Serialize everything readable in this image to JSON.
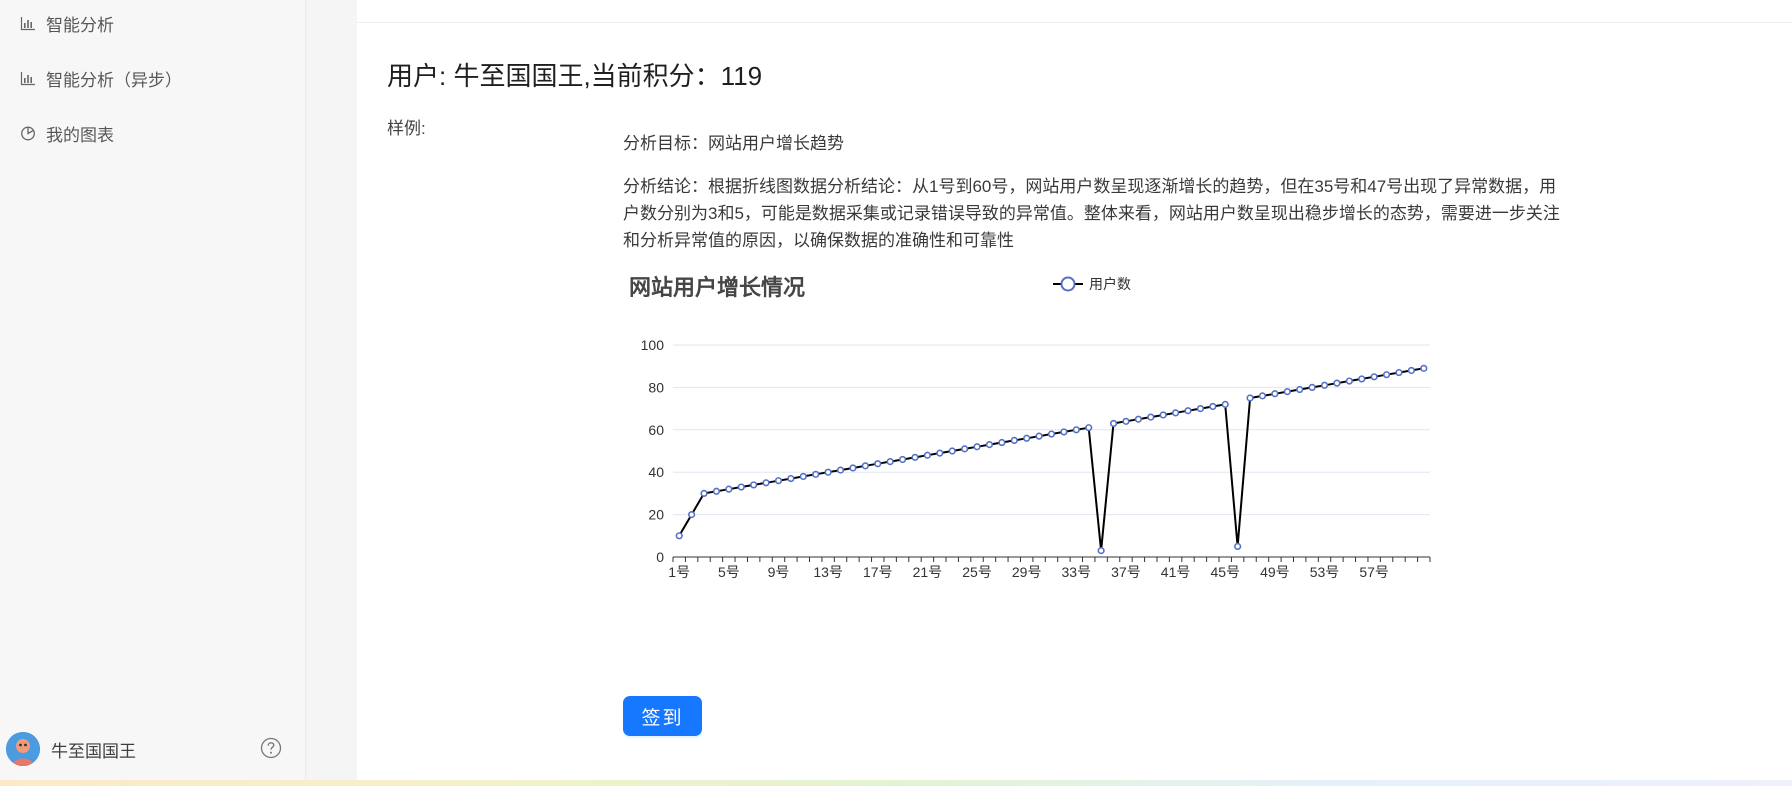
{
  "sidebar": {
    "items": [
      {
        "label": "智能分析",
        "icon": "bar-chart-icon"
      },
      {
        "label": "智能分析（异步）",
        "icon": "bar-chart-icon"
      },
      {
        "label": "我的图表",
        "icon": "pie-chart-icon"
      }
    ],
    "user": {
      "name": "牛至国国王"
    }
  },
  "main": {
    "title": "用户: 牛至国国王,当前积分：119",
    "sample_label": "样例:",
    "goal": "分析目标：网站用户增长趋势",
    "conclusion": "分析结论：根据折线图数据分析结论：从1号到60号，网站用户数呈现逐渐增长的趋势，但在35号和47号出现了异常数据，用户数分别为3和5，可能是数据采集或记录错误导致的异常值。整体来看，网站用户数呈现出稳步增长的态势，需要进一步关注和分析异常值的原因，以确保数据的准确性和可靠性",
    "signin_label": "签到"
  },
  "colors": {
    "primary": "#1677ff",
    "series_point": "#5470c6",
    "series_line": "#000000"
  },
  "chart_data": {
    "type": "line",
    "title": "网站用户增长情况",
    "legend": [
      "用户数"
    ],
    "ylim": [
      0,
      100
    ],
    "yticks": [
      0,
      20,
      40,
      60,
      80,
      100
    ],
    "xticks": [
      "1号",
      "5号",
      "9号",
      "13号",
      "17号",
      "21号",
      "25号",
      "29号",
      "33号",
      "37号",
      "41号",
      "45号",
      "49号",
      "53号",
      "57号"
    ],
    "x": [
      "1号",
      "2号",
      "3号",
      "4号",
      "5号",
      "6号",
      "7号",
      "8号",
      "9号",
      "10号",
      "11号",
      "12号",
      "13号",
      "14号",
      "15号",
      "16号",
      "17号",
      "18号",
      "19号",
      "20号",
      "21号",
      "22号",
      "23号",
      "24号",
      "25号",
      "26号",
      "27号",
      "28号",
      "29号",
      "30号",
      "31号",
      "32号",
      "33号",
      "34号",
      "35号",
      "36号",
      "37号",
      "38号",
      "39号",
      "40号",
      "41号",
      "42号",
      "43号",
      "44号",
      "45号",
      "46号",
      "47号",
      "48号",
      "49号",
      "50号",
      "51号",
      "52号",
      "53号",
      "54号",
      "55号",
      "56号",
      "57号",
      "58号",
      "59号",
      "60号",
      "61号"
    ],
    "series": [
      {
        "name": "用户数",
        "values": [
          10,
          20,
          30,
          31,
          32,
          33,
          34,
          35,
          36,
          37,
          38,
          39,
          40,
          41,
          42,
          43,
          44,
          45,
          46,
          47,
          48,
          49,
          50,
          51,
          52,
          53,
          54,
          55,
          56,
          57,
          58,
          59,
          60,
          61,
          3,
          63,
          64,
          65,
          66,
          67,
          68,
          69,
          70,
          71,
          72,
          5,
          75,
          76,
          77,
          78,
          79,
          80,
          81,
          82,
          83,
          84,
          85,
          86,
          87,
          88,
          89
        ]
      }
    ]
  }
}
